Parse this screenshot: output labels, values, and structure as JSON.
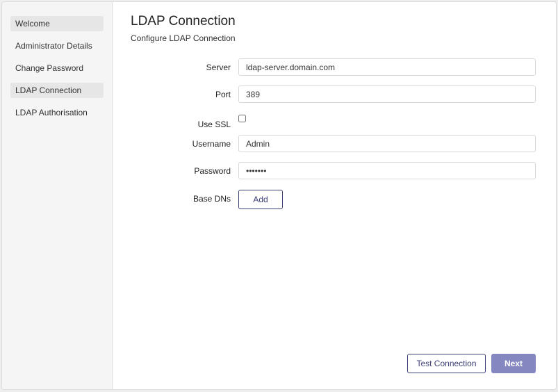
{
  "sidebar": {
    "items": [
      {
        "label": "Welcome"
      },
      {
        "label": "Administrator Details"
      },
      {
        "label": "Change Password"
      },
      {
        "label": "LDAP Connection"
      },
      {
        "label": "LDAP Authorisation"
      }
    ]
  },
  "main": {
    "title": "LDAP Connection",
    "subtitle": "Configure LDAP Connection",
    "form": {
      "server_label": "Server",
      "server_value": "ldap-server.domain.com",
      "port_label": "Port",
      "port_value": "389",
      "ssl_label": "Use SSL",
      "ssl_checked": false,
      "username_label": "Username",
      "username_value": "Admin",
      "password_label": "Password",
      "password_value": "passwrd",
      "basedns_label": "Base DNs",
      "add_label": "Add"
    },
    "footer": {
      "test_label": "Test Connection",
      "next_label": "Next"
    }
  },
  "colors": {
    "accent": "#3c3f74",
    "primary_button": "#8487c0",
    "sidebar_bg": "#f5f5f5",
    "sidebar_active": "#e6e6e6"
  }
}
